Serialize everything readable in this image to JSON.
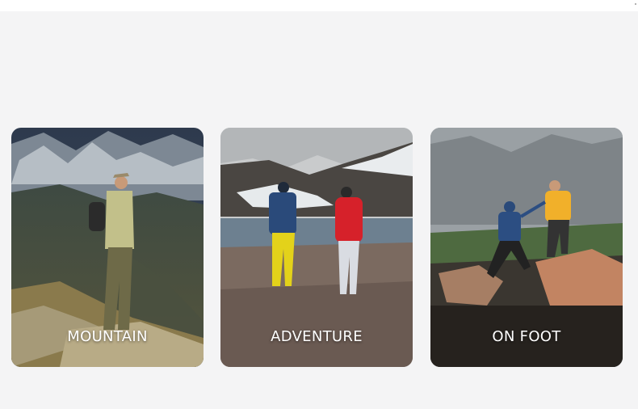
{
  "cards": [
    {
      "label": "MOUNTAIN"
    },
    {
      "label": "ADVENTURE"
    },
    {
      "label": "ON FOOT"
    }
  ]
}
